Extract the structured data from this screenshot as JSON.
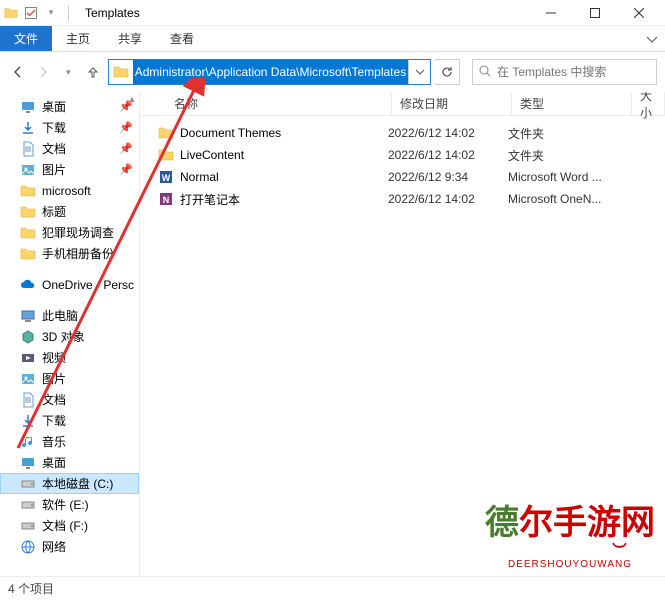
{
  "window": {
    "title": "Templates"
  },
  "ribbon": {
    "file": "文件",
    "home": "主页",
    "share": "共享",
    "view": "查看"
  },
  "address": {
    "path": "Administrator\\Application Data\\Microsoft\\Templates"
  },
  "search": {
    "placeholder": "在 Templates 中搜索"
  },
  "columns": {
    "name": "名称",
    "date": "修改日期",
    "type": "类型",
    "size": "大小"
  },
  "sidebar": {
    "quick": [
      {
        "label": "桌面",
        "pin": true,
        "icon": "desktop"
      },
      {
        "label": "下载",
        "pin": true,
        "icon": "download"
      },
      {
        "label": "文档",
        "pin": true,
        "icon": "document"
      },
      {
        "label": "图片",
        "pin": true,
        "icon": "picture"
      },
      {
        "label": "microsoft",
        "pin": false,
        "icon": "folder"
      },
      {
        "label": "标题",
        "pin": false,
        "icon": "folder"
      },
      {
        "label": "犯罪现场调查",
        "pin": false,
        "icon": "folder"
      },
      {
        "label": "手机相册备份",
        "pin": false,
        "icon": "folder"
      }
    ],
    "onedrive": "OneDrive - Persc",
    "thispc": "此电脑",
    "pc_items": [
      {
        "label": "3D 对象",
        "icon": "3d"
      },
      {
        "label": "视频",
        "icon": "video"
      },
      {
        "label": "图片",
        "icon": "picture"
      },
      {
        "label": "文档",
        "icon": "document"
      },
      {
        "label": "下载",
        "icon": "download"
      },
      {
        "label": "音乐",
        "icon": "music"
      },
      {
        "label": "桌面",
        "icon": "desktop"
      },
      {
        "label": "本地磁盘 (C:)",
        "icon": "drive",
        "selected": true
      },
      {
        "label": "软件 (E:)",
        "icon": "drive"
      },
      {
        "label": "文档 (F:)",
        "icon": "drive"
      }
    ],
    "network": "网络"
  },
  "files": [
    {
      "name": "Document Themes",
      "date": "2022/6/12 14:02",
      "type": "文件夹",
      "icon": "folder"
    },
    {
      "name": "LiveContent",
      "date": "2022/6/12 14:02",
      "type": "文件夹",
      "icon": "folder"
    },
    {
      "name": "Normal",
      "date": "2022/6/12 9:34",
      "type": "Microsoft Word ...",
      "icon": "word"
    },
    {
      "name": "打开笔记本",
      "date": "2022/6/12 14:02",
      "type": "Microsoft OneN...",
      "icon": "onenote"
    }
  ],
  "status": {
    "count": "4 个项目"
  },
  "watermark": {
    "text1": "德",
    "text2": "尔手游网",
    "sub": "DEERSHOUYOUWANG"
  }
}
